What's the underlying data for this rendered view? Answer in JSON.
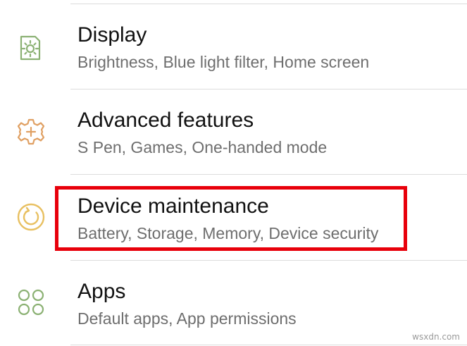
{
  "settings": {
    "items": [
      {
        "title": "Display",
        "subtitle": "Brightness, Blue light filter, Home screen",
        "icon": "display-icon",
        "icon_color": "#8bb173"
      },
      {
        "title": "Advanced features",
        "subtitle": "S Pen, Games, One-handed mode",
        "icon": "advanced-features-gear-icon",
        "icon_color": "#e0a063"
      },
      {
        "title": "Device maintenance",
        "subtitle": "Battery, Storage, Memory, Device security",
        "icon": "device-maintenance-icon",
        "icon_color": "#e8c061"
      },
      {
        "title": "Apps",
        "subtitle": "Default apps, App permissions",
        "icon": "apps-grid-icon",
        "icon_color": "#8bb173"
      }
    ]
  },
  "highlight": {
    "color": "#e8000b",
    "target": "Device maintenance"
  },
  "watermark": "wsxdn.com"
}
